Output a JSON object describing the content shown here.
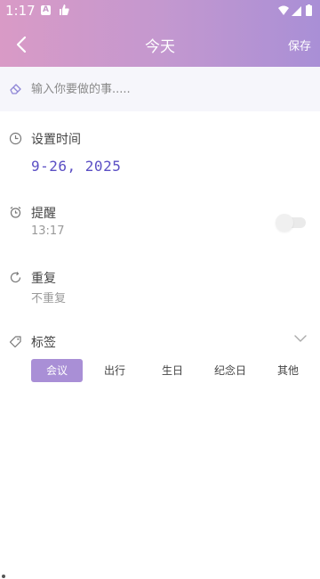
{
  "status_bar": {
    "time": "1:17",
    "app_badge": "A"
  },
  "header": {
    "title": "今天",
    "save_label": "保存"
  },
  "todo": {
    "placeholder": "输入你要做的事....."
  },
  "time_section": {
    "label": "设置时间",
    "value": "9-26, 2025"
  },
  "reminder_section": {
    "label": "提醒",
    "time": "13:17",
    "enabled": false
  },
  "repeat_section": {
    "label": "重复",
    "value": "不重复"
  },
  "tags_section": {
    "label": "标签",
    "items": [
      "会议",
      "出行",
      "生日",
      "纪念日",
      "其他"
    ],
    "selected": "会议"
  },
  "colors": {
    "header_gradient_start": "#d99ac6",
    "header_gradient_end": "#a98fd6",
    "accent": "#a98fd6",
    "date_text": "#5b4fc4"
  }
}
